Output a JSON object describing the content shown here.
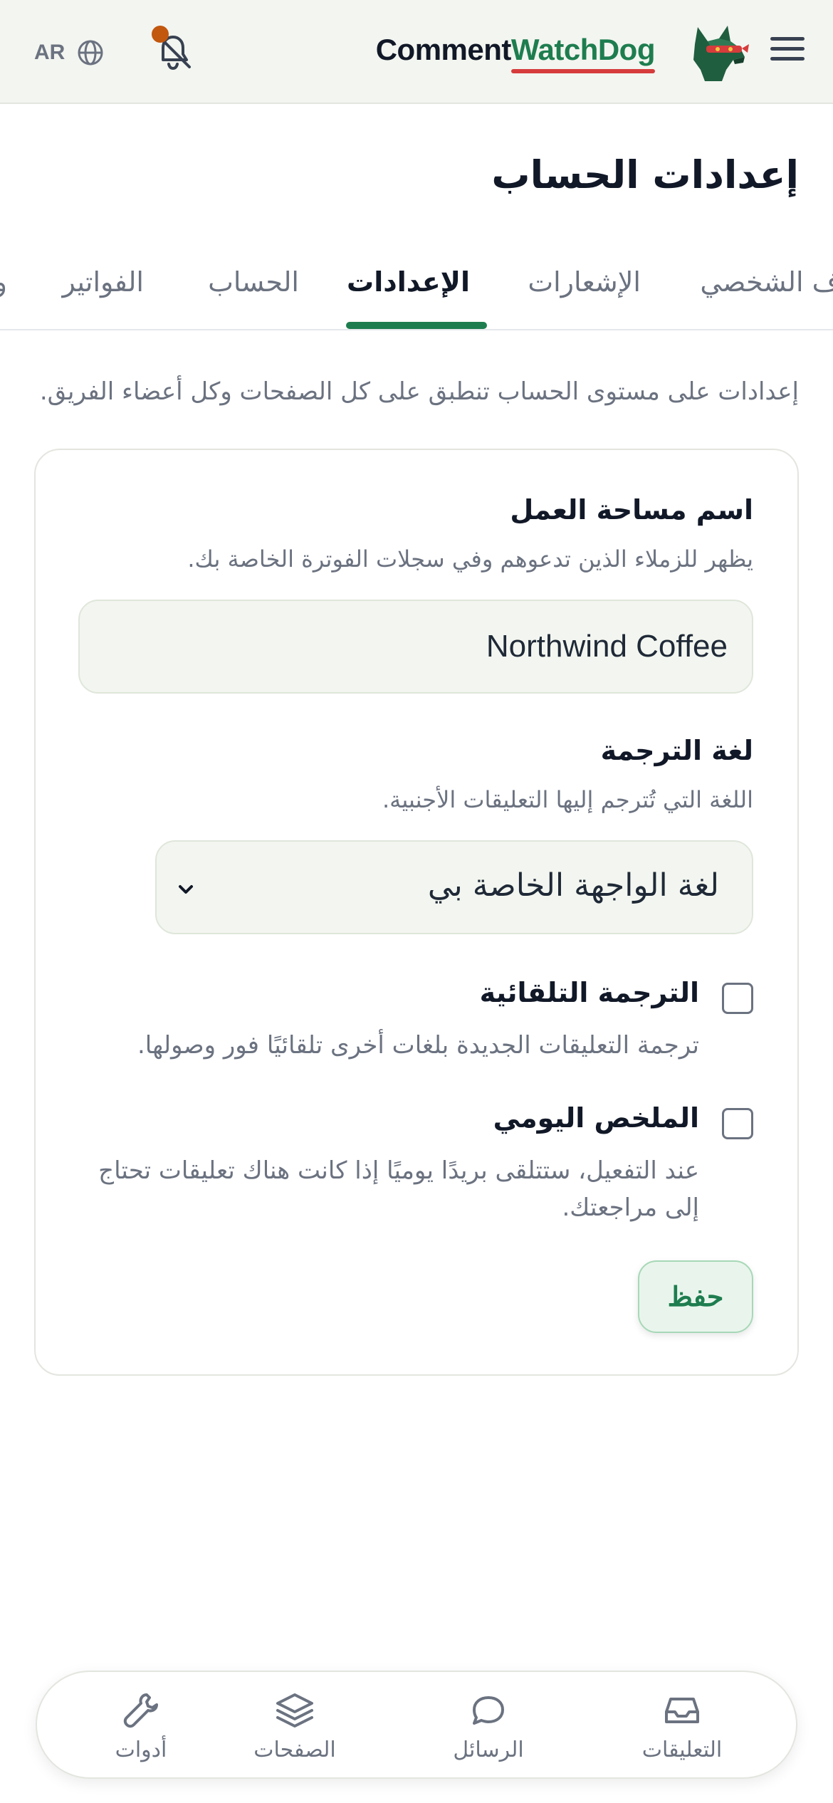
{
  "header": {
    "brand_part1": "Comment",
    "brand_part2": "WatchDog",
    "language_code": "AR"
  },
  "page_title": "إعدادات الحساب",
  "tabs": [
    {
      "label": "ف الشخصي",
      "active": false
    },
    {
      "label": "الإشعارات",
      "active": false
    },
    {
      "label": "الإعدادات",
      "active": true
    },
    {
      "label": "الحساب",
      "active": false
    },
    {
      "label": "الفواتير",
      "active": false
    },
    {
      "label": "و",
      "active": false
    }
  ],
  "intro_text": "إعدادات على مستوى الحساب تنطبق على كل الصفحات وكل أعضاء الفريق.",
  "workspace": {
    "label": "اسم مساحة العمل",
    "help": "يظهر للزملاء الذين تدعوهم وفي سجلات الفوترة الخاصة بك.",
    "value": "Northwind Coffee"
  },
  "translation_language": {
    "label": "لغة الترجمة",
    "help": "اللغة التي تُترجم إليها التعليقات الأجنبية.",
    "selected": "لغة الواجهة الخاصة بي"
  },
  "auto_translate": {
    "title": "الترجمة التلقائية",
    "description": "ترجمة التعليقات الجديدة بلغات أخرى تلقائيًا فور وصولها.",
    "checked": false
  },
  "daily_digest": {
    "title": "الملخص اليومي",
    "description": "عند التفعيل، ستتلقى بريدًا يوميًا إذا كانت هناك تعليقات تحتاج إلى مراجعتك.",
    "checked": false
  },
  "save_label": "حفظ",
  "bottom_nav": [
    {
      "label": "التعليقات",
      "icon": "inbox-icon"
    },
    {
      "label": "الرسائل",
      "icon": "chat-bubble-icon"
    },
    {
      "label": "الصفحات",
      "icon": "layers-icon"
    },
    {
      "label": "أدوات",
      "icon": "wrench-icon"
    }
  ],
  "colors": {
    "accent": "#1e7d4f",
    "underline": "#d63c3c",
    "notification_dot": "#c2570e",
    "header_bg": "#f3f5f0"
  }
}
